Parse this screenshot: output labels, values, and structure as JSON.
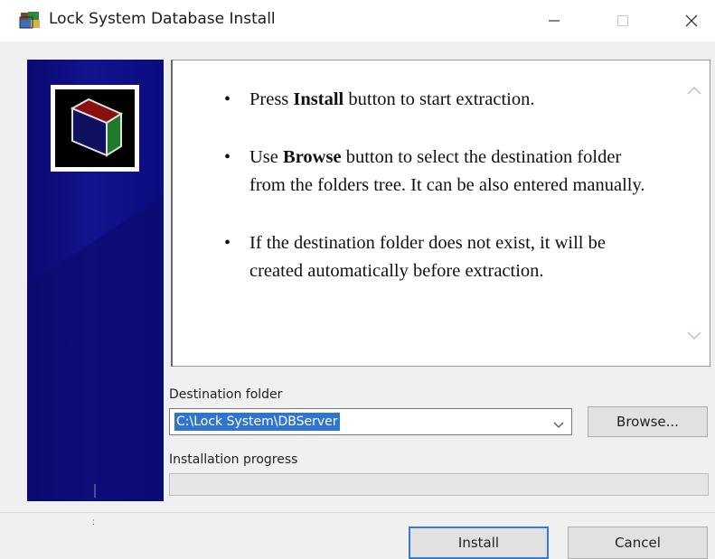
{
  "window": {
    "title": "Lock System Database Install",
    "icon": "installer-icon",
    "controls": [
      "minimize-icon",
      "maximize-icon",
      "close-icon"
    ]
  },
  "side_panel": {
    "logo": "box-logo-icon"
  },
  "info": {
    "items": [
      {
        "pre": "Press ",
        "bold": "Install",
        "post": " button to start extraction."
      },
      {
        "pre": "Use ",
        "bold": "Browse",
        "post": " button to select the destination folder from the folders tree. It can be also entered manually."
      },
      {
        "pre": "If the destination folder does not exist, it will be created automatically before extraction.",
        "bold": "",
        "post": ""
      }
    ]
  },
  "destination": {
    "label": "Destination folder",
    "value": "C:\\Lock System\\DBServer",
    "browse_label": "Browse..."
  },
  "progress": {
    "label": "Installation progress",
    "value": 0
  },
  "footer": {
    "install_label": "Install",
    "cancel_label": "Cancel",
    "grip": ":"
  },
  "colors": {
    "side_panel": "#0e0e84",
    "selection": "#2f74d0",
    "default_button_border": "#3a7bd5"
  }
}
